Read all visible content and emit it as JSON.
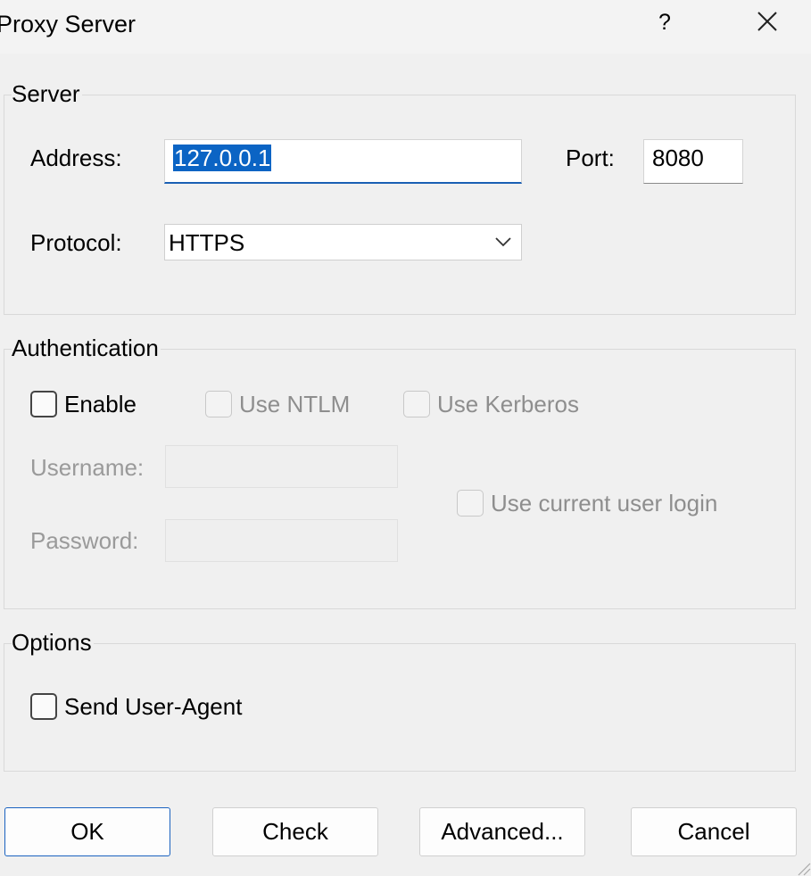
{
  "window": {
    "title": "Proxy Server",
    "help_label": "?",
    "close_icon": "close-icon"
  },
  "server": {
    "legend": "Server",
    "address_label": "Address:",
    "address_value": "127.0.0.1",
    "port_label": "Port:",
    "port_value": "8080",
    "protocol_label": "Protocol:",
    "protocol_value": "HTTPS",
    "protocol_icon": "chevron-down-icon"
  },
  "authentication": {
    "legend": "Authentication",
    "enable_label": "Enable",
    "enable_checked": false,
    "ntlm_label": "Use NTLM",
    "ntlm_checked": false,
    "kerberos_label": "Use Kerberos",
    "kerberos_checked": false,
    "username_label": "Username:",
    "username_value": "",
    "password_label": "Password:",
    "password_value": "",
    "current_user_label": "Use current user login",
    "current_user_checked": false
  },
  "options": {
    "legend": "Options",
    "send_user_agent_label": "Send User-Agent",
    "send_user_agent_checked": false
  },
  "buttons": {
    "ok": "OK",
    "check": "Check",
    "advanced": "Advanced...",
    "cancel": "Cancel"
  },
  "colors": {
    "selection": "#0b64c4",
    "focus_underline": "#1a5fb4",
    "default_button_border": "#1a62c0",
    "window_background": "#f0f0f0"
  }
}
